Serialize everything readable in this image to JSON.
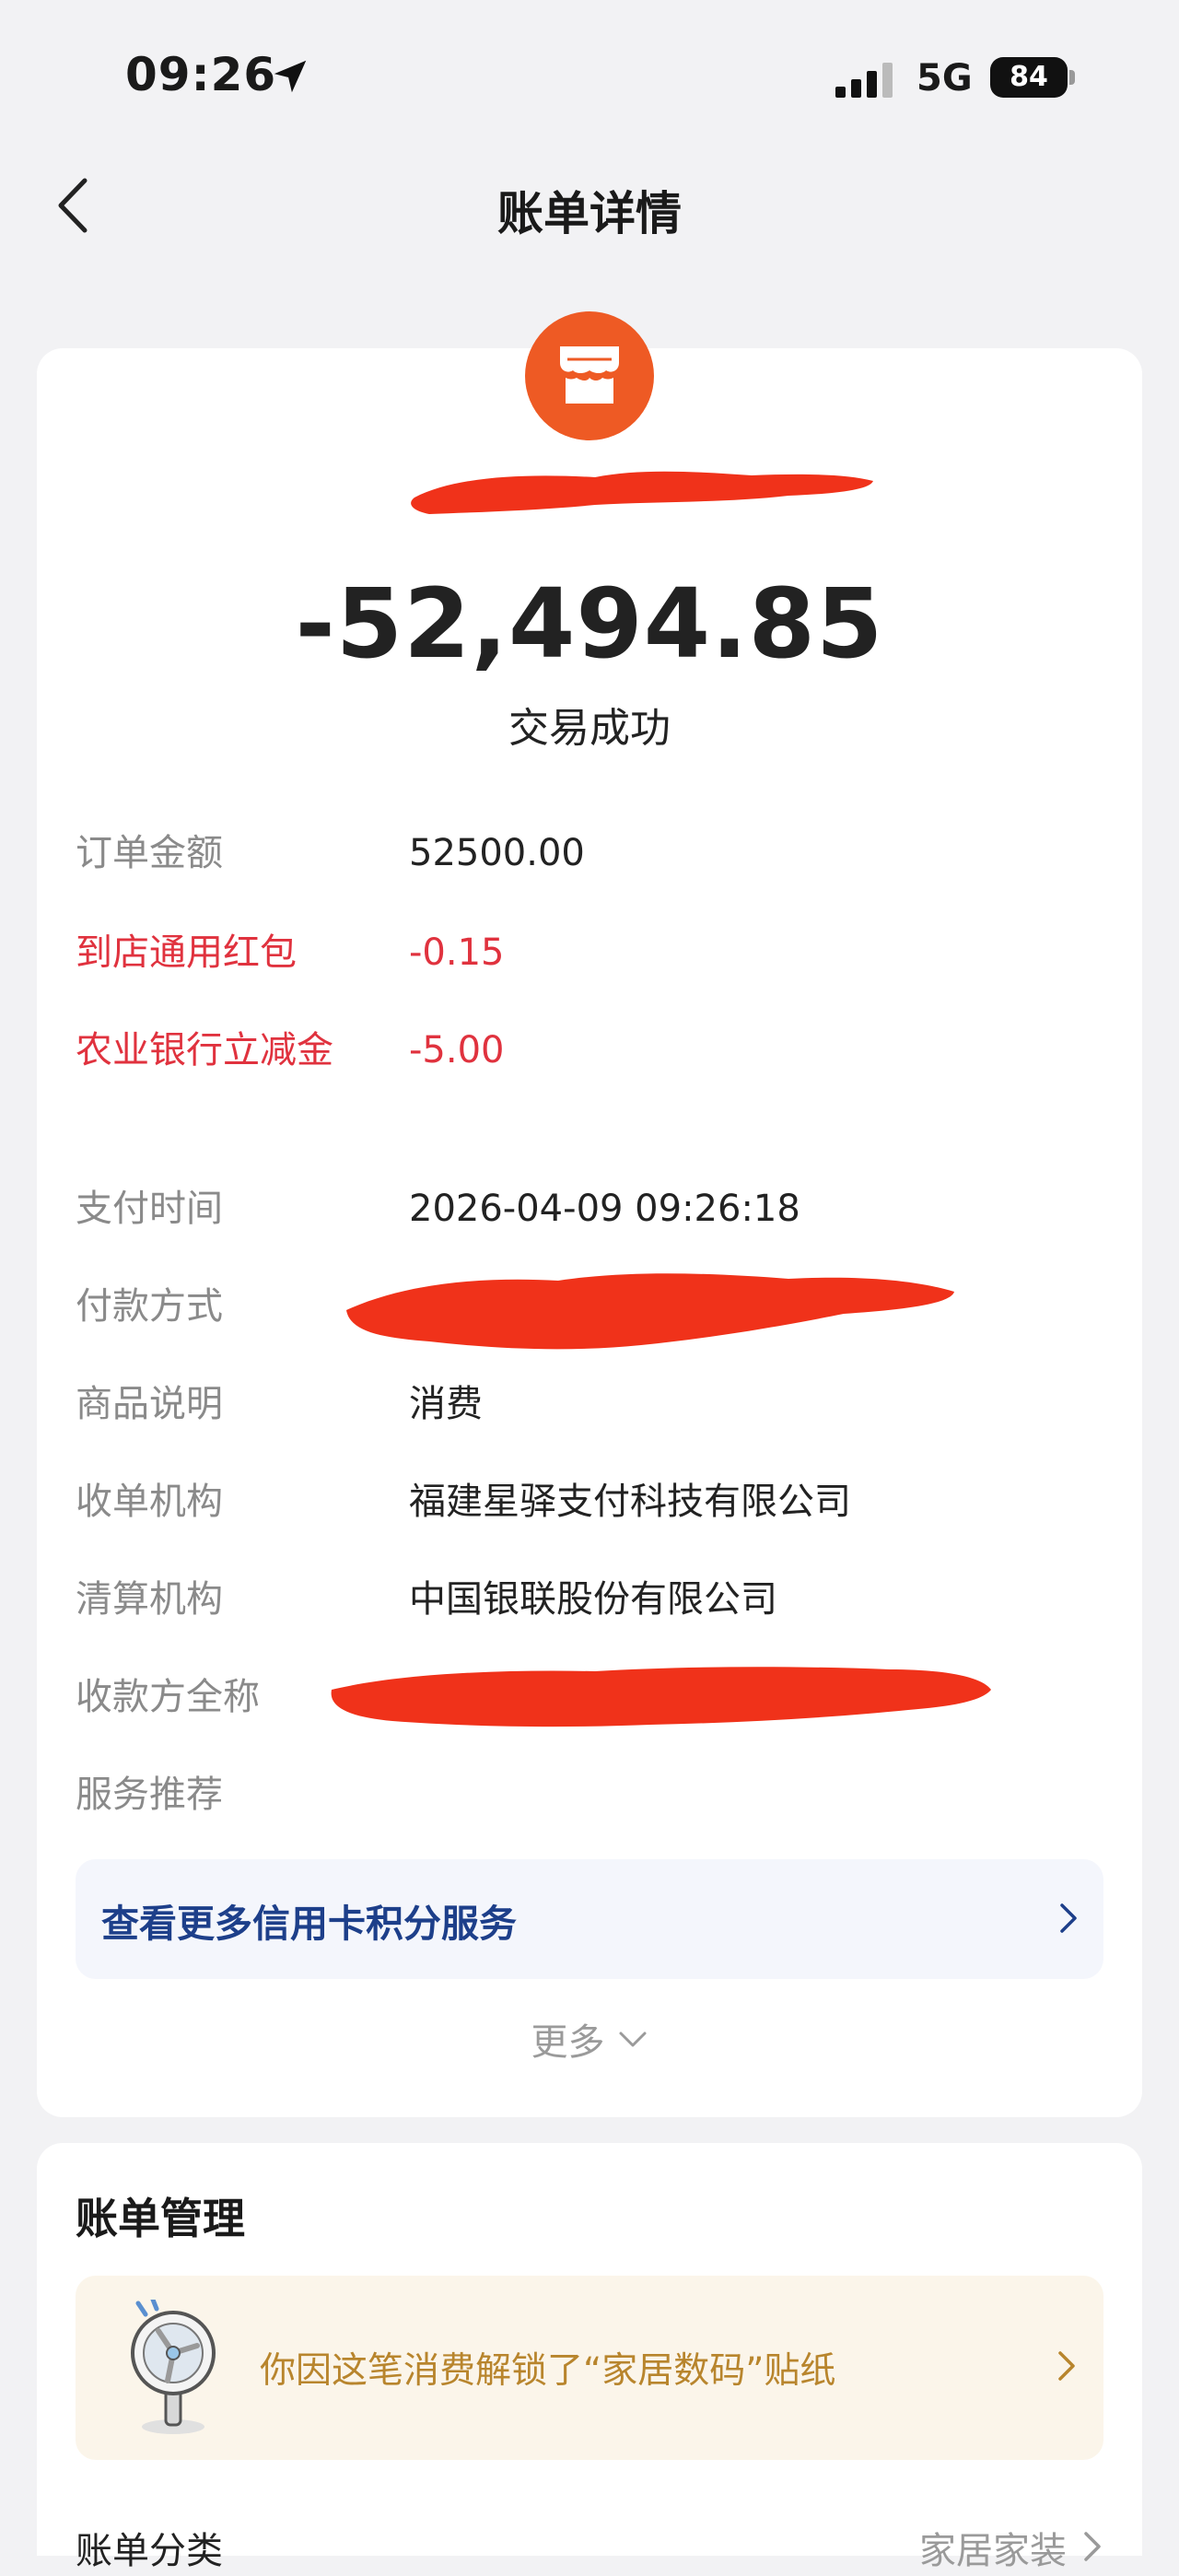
{
  "status_bar": {
    "time": "09:26",
    "network": "5G",
    "battery": "84",
    "icons": [
      "location-arrow-icon",
      "signal-bars-icon",
      "battery-icon"
    ]
  },
  "nav": {
    "title": "账单详情",
    "back_icon": "chevron-left-icon"
  },
  "summary": {
    "merchant_icon": "shop-icon",
    "amount": "-52,494.85",
    "status": "交易成功",
    "accent_color": "#ee5a24"
  },
  "details": [
    {
      "label": "订单金额",
      "value": "52500.00",
      "highlight": false
    },
    {
      "label": "到店通用红包",
      "value": "-0.15",
      "highlight": true
    },
    {
      "label": "农业银行立减金",
      "value": "-5.00",
      "highlight": true
    },
    {
      "label": "支付时间",
      "value": "2026-04-09 09:26:18",
      "highlight": false
    },
    {
      "label": "付款方式",
      "value": "",
      "highlight": false
    },
    {
      "label": "商品说明",
      "value": "消费",
      "highlight": false
    },
    {
      "label": "收单机构",
      "value": "福建星驿支付科技有限公司",
      "highlight": false
    },
    {
      "label": "清算机构",
      "value": "中国银联股份有限公司",
      "highlight": false
    },
    {
      "label": "收款方全称",
      "value": "",
      "highlight": false
    },
    {
      "label": "服务推荐",
      "value": "",
      "highlight": false
    }
  ],
  "service": {
    "label": "查看更多信用卡积分服务",
    "color": "#1d3f8a"
  },
  "more": {
    "label": "更多"
  },
  "management": {
    "title": "账单管理",
    "sticker_text": "你因这笔消费解锁了“家居数码”贴纸",
    "category_label": "账单分类",
    "category_value": "家居家装"
  },
  "colors": {
    "highlight_red": "#e0323e",
    "redaction": "#f0321a",
    "sticker_text": "#b8852d"
  }
}
